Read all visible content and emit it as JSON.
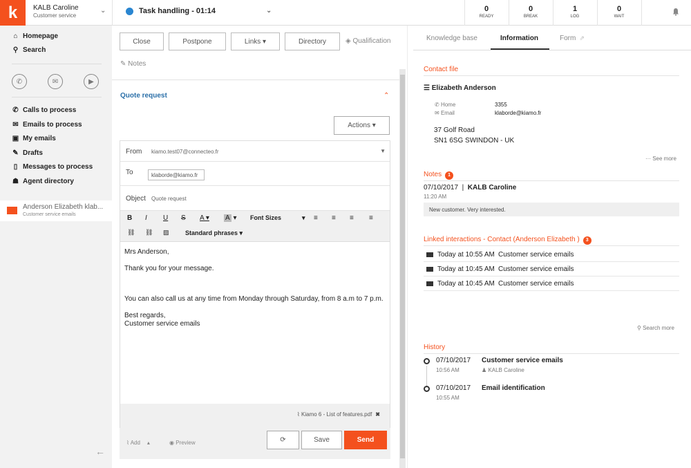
{
  "app": {
    "logo_letter": "k"
  },
  "agent": {
    "name": "KALB Caroline",
    "service": "Customer service"
  },
  "task": {
    "title": "Task handling - 01:14"
  },
  "stats": [
    {
      "value": "0",
      "label": "READY"
    },
    {
      "value": "0",
      "label": "BREAK"
    },
    {
      "value": "1",
      "label": "LOG"
    },
    {
      "value": "0",
      "label": "WAIT"
    }
  ],
  "sidebar": {
    "top_items": [
      {
        "label": "Homepage",
        "icon": "home-icon"
      },
      {
        "label": "Search",
        "icon": "search-icon"
      }
    ],
    "items": [
      {
        "label": "Calls to process",
        "icon": "phone-icon"
      },
      {
        "label": "Emails to process",
        "icon": "envelope-icon"
      },
      {
        "label": "My emails",
        "icon": "inbox-icon"
      },
      {
        "label": "Drafts",
        "icon": "pencil-icon"
      },
      {
        "label": "Messages to process",
        "icon": "mobile-icon"
      },
      {
        "label": "Agent directory",
        "icon": "contact-book-icon"
      }
    ],
    "active_task": {
      "title": "Anderson Elizabeth klab...",
      "subtitle": "Customer service emails"
    }
  },
  "toolbar": {
    "close_label": "Close",
    "postpone_label": "Postpone",
    "links_label": "Links ▾",
    "directory_label": "Directory",
    "qualification_label": "Qualification",
    "notes_label": "Notes"
  },
  "quote": {
    "title": "Quote request",
    "actions_label": "Actions ▾",
    "from_label": "From",
    "from_value": "kiamo.test07@connecteo.fr",
    "to_label": "To",
    "to_value": "klaborde@kiamo.fr",
    "object_label": "Object",
    "object_value": "Quote request",
    "font_sizes_label": "Font Sizes",
    "standard_phrases_label": "Standard phrases ▾",
    "body": {
      "greeting": "Mrs Anderson,",
      "line1": "Thank you for your message.",
      "line2": "You can also call us at any time from Monday through Saturday, from 8 a.m to 7 p.m.",
      "closing": "Best regards,",
      "signature": "Customer service emails"
    },
    "attachment": "Kiamo 6 - List of features.pdf",
    "add_label": "Add",
    "preview_label": "Preview",
    "save_label": "Save",
    "send_label": "Send"
  },
  "right": {
    "tabs": [
      "Knowledge base",
      "Information",
      "Form"
    ],
    "contact_file_title": "Contact file",
    "contact": {
      "name": "Elizabeth Anderson",
      "home_label": "Home",
      "home_value": "3355",
      "email_label": "Email",
      "email_value": "klaborde@kiamo.fr",
      "address1": "37 Golf Road",
      "address2": "SN1 6SG SWINDON - UK",
      "see_more": "See more"
    },
    "notes": {
      "title": "Notes",
      "count": "1",
      "date": "07/10/2017",
      "author": "KALB Caroline",
      "time": "11:20 AM",
      "text": "New customer. Very interested."
    },
    "linked": {
      "title": "Linked interactions - Contact (Anderson Elizabeth )",
      "count": "3",
      "rows": [
        {
          "date": "Today at 10:55 AM",
          "channel": "Customer service emails"
        },
        {
          "date": "Today at 10:45 AM",
          "channel": "Customer service emails"
        },
        {
          "date": "Today at 10:45 AM",
          "channel": "Customer service emails"
        }
      ],
      "search_more": "Search more"
    },
    "history": {
      "title": "History",
      "items": [
        {
          "date": "07/10/2017",
          "title": "Customer service emails",
          "time": "10:56 AM",
          "agent": "KALB Caroline"
        },
        {
          "date": "07/10/2017",
          "title": "Email identification",
          "time": "10:55 AM"
        }
      ]
    }
  },
  "colors": {
    "accent": "#f4511e",
    "link_blue": "#2a6fa8",
    "status_blue": "#2a86d1"
  }
}
